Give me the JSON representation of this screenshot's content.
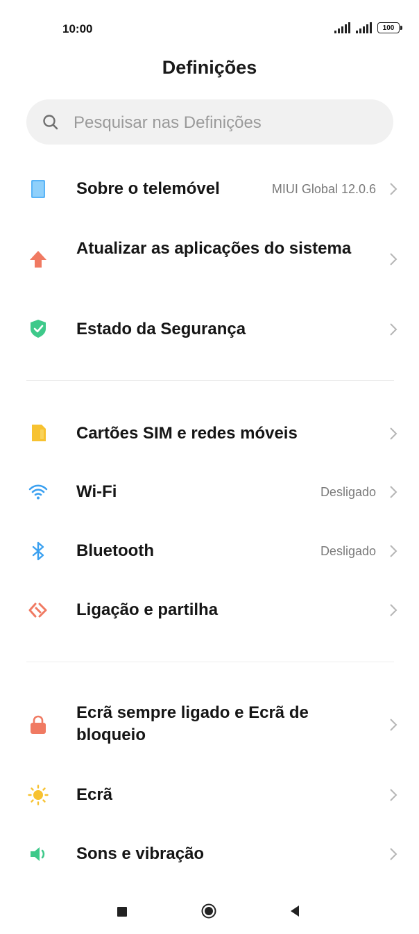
{
  "status_bar": {
    "time": "10:00",
    "battery": "100"
  },
  "header": {
    "title": "Definições"
  },
  "search": {
    "placeholder": "Pesquisar nas Definições"
  },
  "items": [
    {
      "label": "Sobre o telemóvel",
      "value": "MIUI Global 12.0.6",
      "icon": "phone-icon",
      "color": "#3aa0f0"
    },
    {
      "label": "Atualizar as aplicações do sistema",
      "value": "",
      "icon": "arrow-up-icon",
      "color": "#f07a62"
    },
    {
      "label": "Estado da Segurança",
      "value": "",
      "icon": "shield-icon",
      "color": "#3ec98a"
    },
    {
      "label": "Cartões SIM e redes móveis",
      "value": "",
      "icon": "sim-card-icon",
      "color": "#f7c231"
    },
    {
      "label": "Wi-Fi",
      "value": "Desligado",
      "icon": "wifi-icon",
      "color": "#3aa0f0"
    },
    {
      "label": "Bluetooth",
      "value": "Desligado",
      "icon": "bluetooth-icon",
      "color": "#3aa0f0"
    },
    {
      "label": "Ligação e partilha",
      "value": "",
      "icon": "connection-share-icon",
      "color": "#f07a62"
    },
    {
      "label": "Ecrã sempre ligado e Ecrã de bloqueio",
      "value": "",
      "icon": "lock-icon",
      "color": "#f07a62"
    },
    {
      "label": "Ecrã",
      "value": "",
      "icon": "sun-icon",
      "color": "#f7c231"
    },
    {
      "label": "Sons e vibração",
      "value": "",
      "icon": "speaker-icon",
      "color": "#3ec98a"
    }
  ]
}
